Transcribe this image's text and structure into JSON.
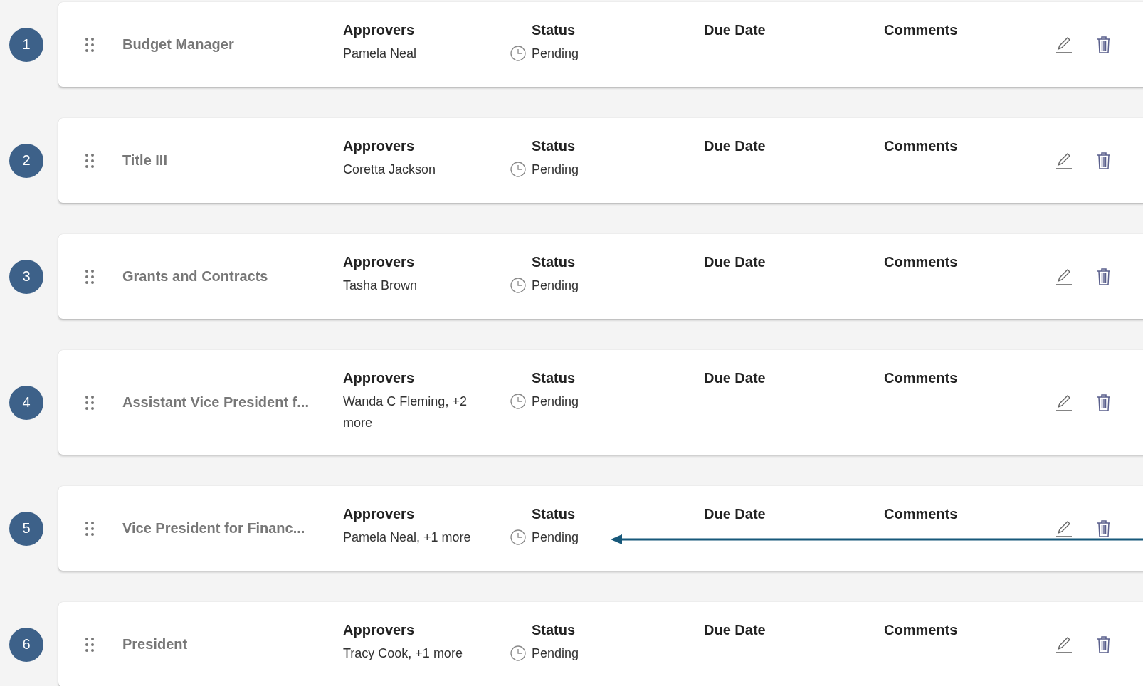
{
  "steps": [
    {
      "number": "1",
      "name": "Budget Manager",
      "approvers_label": "Approvers",
      "approvers": "Pamela Neal",
      "status_label": "Status",
      "status": "Pending",
      "due_date_label": "Due Date",
      "comments_label": "Comments"
    },
    {
      "number": "2",
      "name": "Title III",
      "approvers_label": "Approvers",
      "approvers": "Coretta Jackson",
      "status_label": "Status",
      "status": "Pending",
      "due_date_label": "Due Date",
      "comments_label": "Comments"
    },
    {
      "number": "3",
      "name": "Grants and Contracts",
      "approvers_label": "Approvers",
      "approvers": "Tasha Brown",
      "status_label": "Status",
      "status": "Pending",
      "due_date_label": "Due Date",
      "comments_label": "Comments"
    },
    {
      "number": "4",
      "name": "Assistant Vice President f...",
      "approvers_label": "Approvers",
      "approvers": "Wanda C Fleming, +2 more",
      "status_label": "Status",
      "status": "Pending",
      "due_date_label": "Due Date",
      "comments_label": "Comments"
    },
    {
      "number": "5",
      "name": "Vice President for Financ...",
      "approvers_label": "Approvers",
      "approvers": "Pamela Neal, +1 more",
      "status_label": "Status",
      "status": "Pending",
      "due_date_label": "Due Date",
      "comments_label": "Comments"
    },
    {
      "number": "6",
      "name": "President",
      "approvers_label": "Approvers",
      "approvers": "Tracy Cook, +1 more",
      "status_label": "Status",
      "status": "Pending",
      "due_date_label": "Due Date",
      "comments_label": "Comments"
    }
  ]
}
